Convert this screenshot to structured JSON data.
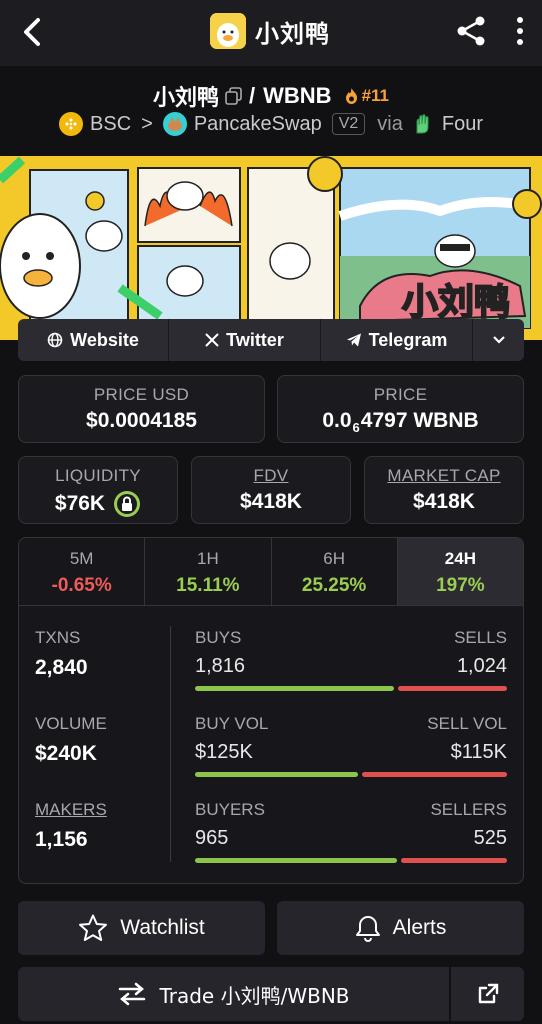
{
  "topbar": {
    "title": "小刘鸭"
  },
  "pair": {
    "base": "小刘鸭",
    "slash": "/",
    "quote": "WBNB",
    "rank": "#11"
  },
  "dex": {
    "chain": "BSC",
    "dex_name": "PancakeSwap",
    "version": "V2",
    "via": "via",
    "launchpad": "Four"
  },
  "links": {
    "website": "Website",
    "twitter": "Twitter",
    "telegram": "Telegram"
  },
  "price": {
    "usd_label": "PRICE USD",
    "usd_value": "$0.0004185",
    "native_label": "PRICE",
    "native_prefix": "0.0",
    "native_zeros": "6",
    "native_rest": "4797 WBNB"
  },
  "metrics": {
    "liquidity_label": "LIQUIDITY",
    "liquidity_value": "$76K",
    "fdv_label": "FDV",
    "fdv_value": "$418K",
    "mcap_label": "MARKET CAP",
    "mcap_value": "$418K"
  },
  "tabs": [
    {
      "label": "5M",
      "value": "-0.65%"
    },
    {
      "label": "1H",
      "value": "15.11%"
    },
    {
      "label": "6H",
      "value": "25.25%"
    },
    {
      "label": "24H",
      "value": "197%"
    }
  ],
  "stats": {
    "txns_label": "TXNS",
    "txns_value": "2,840",
    "volume_label": "VOLUME",
    "volume_value": "$240K",
    "makers_label": "MAKERS",
    "makers_value": "1,156",
    "buys_label": "BUYS",
    "buys_value": "1,816",
    "sells_label": "SELLS",
    "sells_value": "1,024",
    "buyvol_label": "BUY VOL",
    "buyvol_value": "$125K",
    "sellvol_label": "SELL VOL",
    "sellvol_value": "$115K",
    "buyers_label": "BUYERS",
    "buyers_value": "965",
    "sellers_label": "SELLERS",
    "sellers_value": "525",
    "buys_fraction": 0.639,
    "buyvol_fraction": 0.521,
    "buyers_fraction": 0.648
  },
  "actions": {
    "watchlist": "Watchlist",
    "alerts": "Alerts",
    "trade": "Trade 小刘鸭/WBNB"
  },
  "colors": {
    "positive": "#9acd52",
    "negative": "#ef5a5a",
    "rank": "#f8a13a",
    "banner": "#f2c928"
  }
}
